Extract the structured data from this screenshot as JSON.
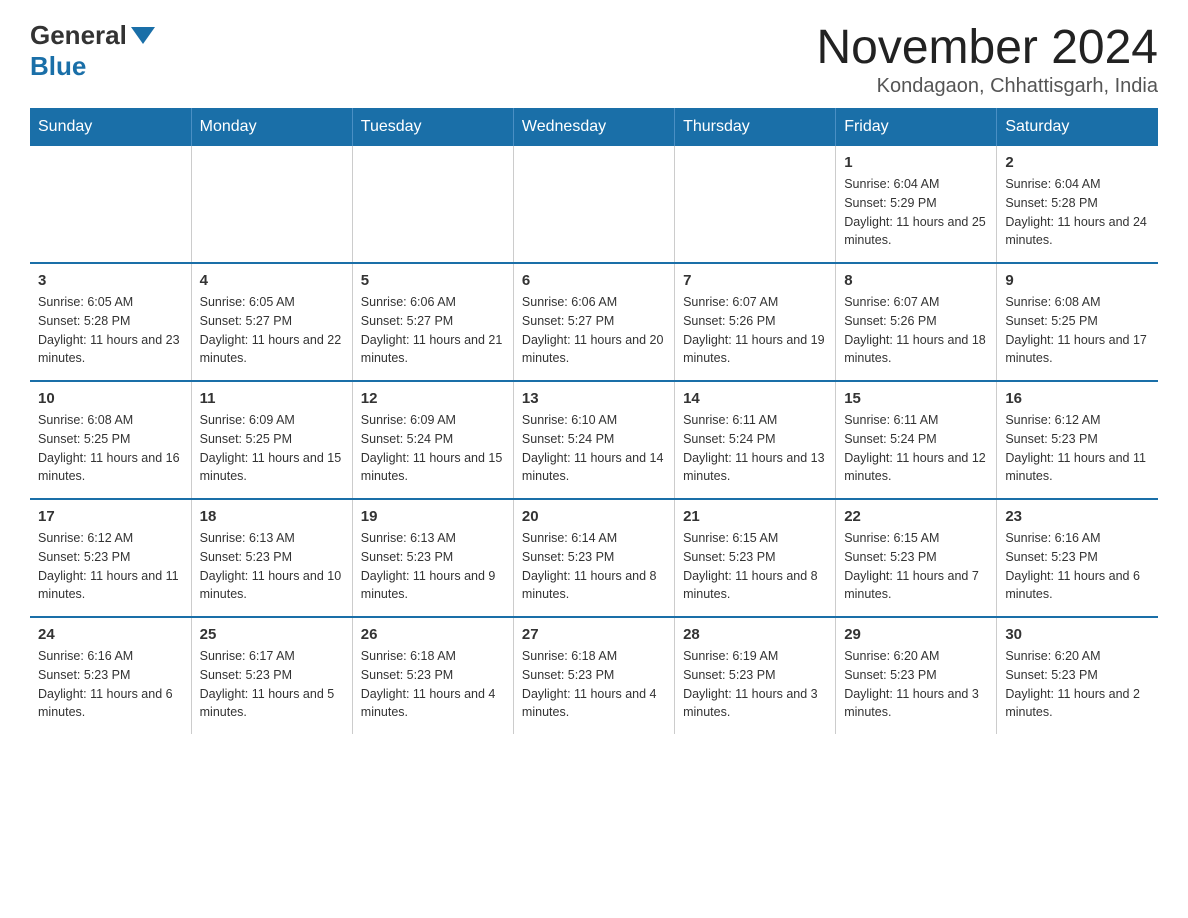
{
  "header": {
    "logo_general": "General",
    "logo_blue": "Blue",
    "month_title": "November 2024",
    "location": "Kondagaon, Chhattisgarh, India"
  },
  "days_of_week": [
    "Sunday",
    "Monday",
    "Tuesday",
    "Wednesday",
    "Thursday",
    "Friday",
    "Saturday"
  ],
  "weeks": [
    [
      {
        "day": "",
        "info": ""
      },
      {
        "day": "",
        "info": ""
      },
      {
        "day": "",
        "info": ""
      },
      {
        "day": "",
        "info": ""
      },
      {
        "day": "",
        "info": ""
      },
      {
        "day": "1",
        "info": "Sunrise: 6:04 AM\nSunset: 5:29 PM\nDaylight: 11 hours and 25 minutes."
      },
      {
        "day": "2",
        "info": "Sunrise: 6:04 AM\nSunset: 5:28 PM\nDaylight: 11 hours and 24 minutes."
      }
    ],
    [
      {
        "day": "3",
        "info": "Sunrise: 6:05 AM\nSunset: 5:28 PM\nDaylight: 11 hours and 23 minutes."
      },
      {
        "day": "4",
        "info": "Sunrise: 6:05 AM\nSunset: 5:27 PM\nDaylight: 11 hours and 22 minutes."
      },
      {
        "day": "5",
        "info": "Sunrise: 6:06 AM\nSunset: 5:27 PM\nDaylight: 11 hours and 21 minutes."
      },
      {
        "day": "6",
        "info": "Sunrise: 6:06 AM\nSunset: 5:27 PM\nDaylight: 11 hours and 20 minutes."
      },
      {
        "day": "7",
        "info": "Sunrise: 6:07 AM\nSunset: 5:26 PM\nDaylight: 11 hours and 19 minutes."
      },
      {
        "day": "8",
        "info": "Sunrise: 6:07 AM\nSunset: 5:26 PM\nDaylight: 11 hours and 18 minutes."
      },
      {
        "day": "9",
        "info": "Sunrise: 6:08 AM\nSunset: 5:25 PM\nDaylight: 11 hours and 17 minutes."
      }
    ],
    [
      {
        "day": "10",
        "info": "Sunrise: 6:08 AM\nSunset: 5:25 PM\nDaylight: 11 hours and 16 minutes."
      },
      {
        "day": "11",
        "info": "Sunrise: 6:09 AM\nSunset: 5:25 PM\nDaylight: 11 hours and 15 minutes."
      },
      {
        "day": "12",
        "info": "Sunrise: 6:09 AM\nSunset: 5:24 PM\nDaylight: 11 hours and 15 minutes."
      },
      {
        "day": "13",
        "info": "Sunrise: 6:10 AM\nSunset: 5:24 PM\nDaylight: 11 hours and 14 minutes."
      },
      {
        "day": "14",
        "info": "Sunrise: 6:11 AM\nSunset: 5:24 PM\nDaylight: 11 hours and 13 minutes."
      },
      {
        "day": "15",
        "info": "Sunrise: 6:11 AM\nSunset: 5:24 PM\nDaylight: 11 hours and 12 minutes."
      },
      {
        "day": "16",
        "info": "Sunrise: 6:12 AM\nSunset: 5:23 PM\nDaylight: 11 hours and 11 minutes."
      }
    ],
    [
      {
        "day": "17",
        "info": "Sunrise: 6:12 AM\nSunset: 5:23 PM\nDaylight: 11 hours and 11 minutes."
      },
      {
        "day": "18",
        "info": "Sunrise: 6:13 AM\nSunset: 5:23 PM\nDaylight: 11 hours and 10 minutes."
      },
      {
        "day": "19",
        "info": "Sunrise: 6:13 AM\nSunset: 5:23 PM\nDaylight: 11 hours and 9 minutes."
      },
      {
        "day": "20",
        "info": "Sunrise: 6:14 AM\nSunset: 5:23 PM\nDaylight: 11 hours and 8 minutes."
      },
      {
        "day": "21",
        "info": "Sunrise: 6:15 AM\nSunset: 5:23 PM\nDaylight: 11 hours and 8 minutes."
      },
      {
        "day": "22",
        "info": "Sunrise: 6:15 AM\nSunset: 5:23 PM\nDaylight: 11 hours and 7 minutes."
      },
      {
        "day": "23",
        "info": "Sunrise: 6:16 AM\nSunset: 5:23 PM\nDaylight: 11 hours and 6 minutes."
      }
    ],
    [
      {
        "day": "24",
        "info": "Sunrise: 6:16 AM\nSunset: 5:23 PM\nDaylight: 11 hours and 6 minutes."
      },
      {
        "day": "25",
        "info": "Sunrise: 6:17 AM\nSunset: 5:23 PM\nDaylight: 11 hours and 5 minutes."
      },
      {
        "day": "26",
        "info": "Sunrise: 6:18 AM\nSunset: 5:23 PM\nDaylight: 11 hours and 4 minutes."
      },
      {
        "day": "27",
        "info": "Sunrise: 6:18 AM\nSunset: 5:23 PM\nDaylight: 11 hours and 4 minutes."
      },
      {
        "day": "28",
        "info": "Sunrise: 6:19 AM\nSunset: 5:23 PM\nDaylight: 11 hours and 3 minutes."
      },
      {
        "day": "29",
        "info": "Sunrise: 6:20 AM\nSunset: 5:23 PM\nDaylight: 11 hours and 3 minutes."
      },
      {
        "day": "30",
        "info": "Sunrise: 6:20 AM\nSunset: 5:23 PM\nDaylight: 11 hours and 2 minutes."
      }
    ]
  ]
}
